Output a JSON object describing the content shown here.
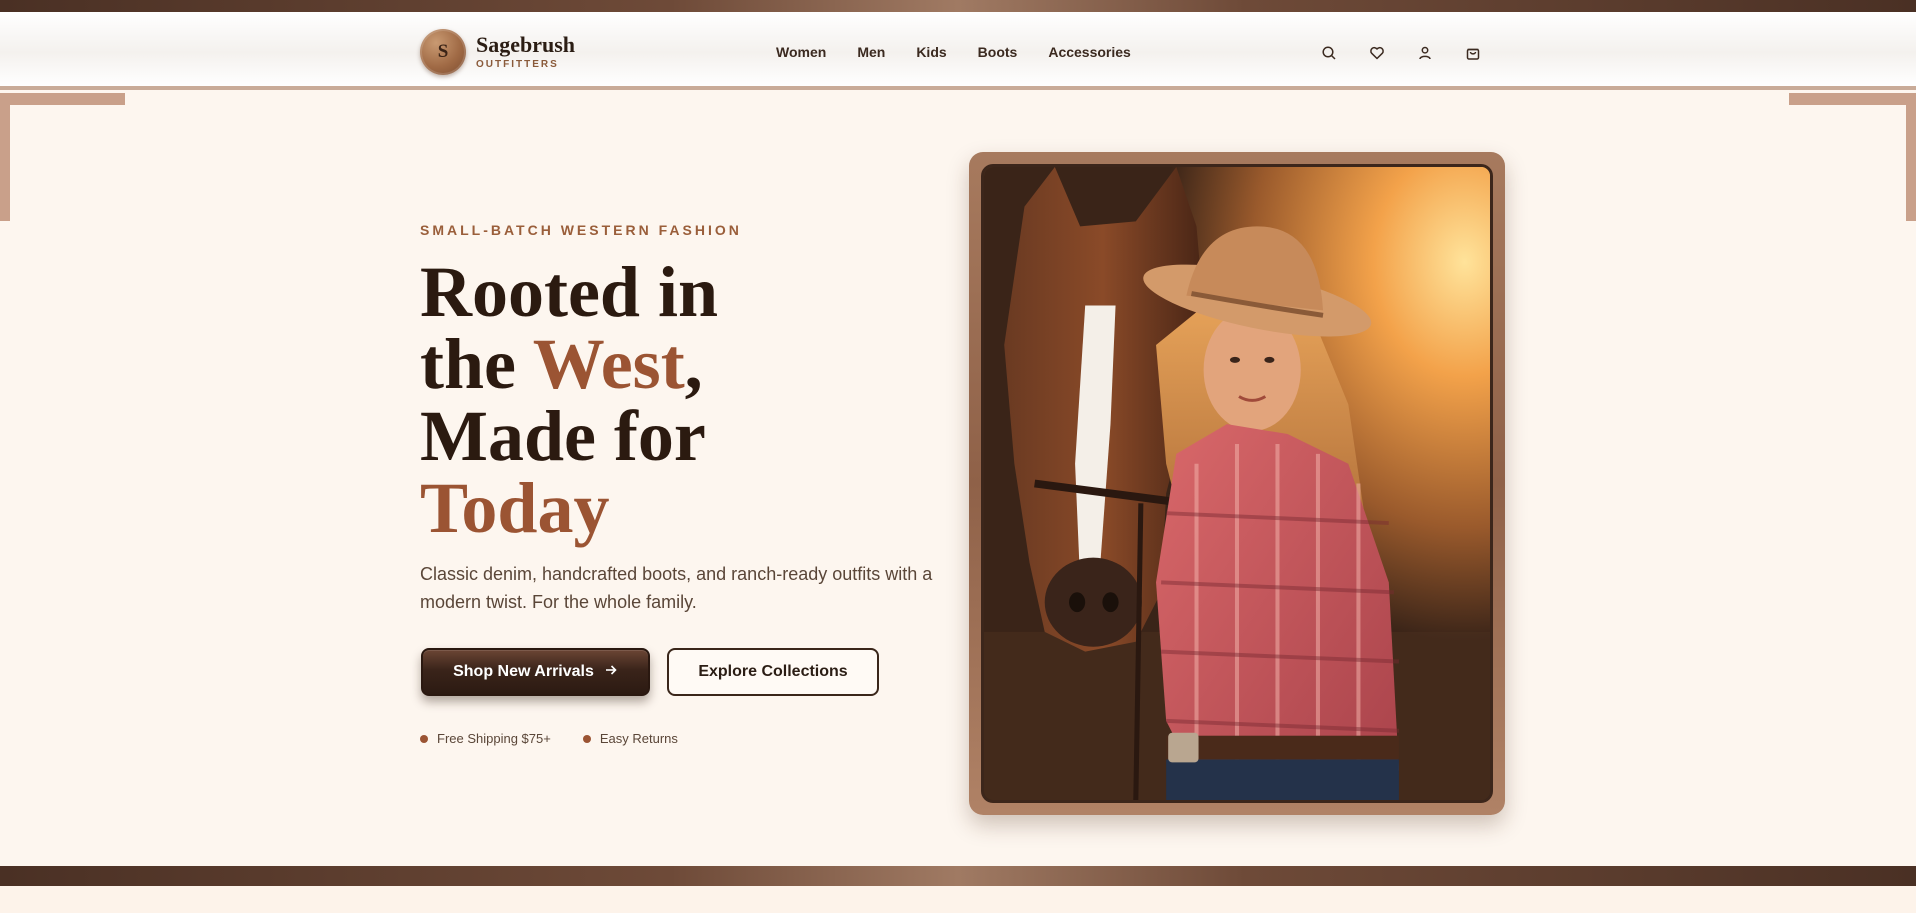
{
  "brand": {
    "initial": "S",
    "name": "Sagebrush",
    "tagline": "OUTFITTERS"
  },
  "nav": {
    "items": [
      {
        "label": "Women"
      },
      {
        "label": "Men"
      },
      {
        "label": "Kids"
      },
      {
        "label": "Boots"
      },
      {
        "label": "Accessories"
      }
    ]
  },
  "header_actions": {
    "icons": [
      "search-icon",
      "heart-icon",
      "user-icon",
      "bag-icon"
    ]
  },
  "hero": {
    "eyebrow": "SMALL-BATCH WESTERN FASHION",
    "headline": {
      "line1": "Rooted in",
      "line2_prefix": "the ",
      "line2_accent": "West",
      "line2_suffix": ",",
      "line3": "Made for",
      "line4_accent": "Today"
    },
    "subtext": "Classic denim, handcrafted boots, and ranch-ready outfits with a modern twist. For the whole family.",
    "primary_cta": "Shop New Arrivals",
    "primary_cta_icon": "arrow-right-icon",
    "secondary_cta": "Explore Collections",
    "perks": [
      {
        "label": "Free Shipping $75+"
      },
      {
        "label": "Easy Returns"
      }
    ]
  },
  "colors": {
    "accent": "#9b5433",
    "dark": "#2b1a10",
    "background": "#fdf6ef",
    "frame": "#a77a5e"
  }
}
